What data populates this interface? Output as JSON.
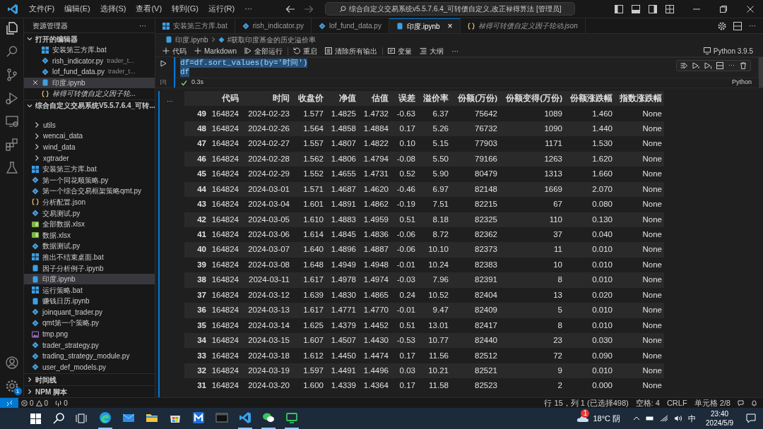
{
  "menu": [
    "文件(F)",
    "编辑(E)",
    "选择(S)",
    "查看(V)",
    "转到(G)",
    "运行(R)",
    "···"
  ],
  "command_center": "综合自定义交易系统v5.5.7.6.4_可转债自定义,改正禄得算法 [管理员]",
  "sidebar": {
    "title": "资源管理器",
    "more": "···",
    "open_editors": {
      "title": "打开的编辑器",
      "expanded": true,
      "items": [
        {
          "kind": "bat",
          "name": "安装第三方库.bat",
          "selected": false
        },
        {
          "kind": "py",
          "name": "rish_indicator.py",
          "desc": "trader_t...",
          "selected": false
        },
        {
          "kind": "py",
          "name": "lof_fund_data.py",
          "desc": "trader_t...",
          "selected": false
        },
        {
          "kind": "ipynb",
          "name": "印度.ipynb",
          "selected": true
        },
        {
          "kind": "json",
          "name": "禄得可转债自定义因子轮...",
          "italic": true,
          "selected": false
        }
      ]
    },
    "project": {
      "title": "综合自定义交易系统V5.5.7.6.4_可转...",
      "expanded": true,
      "items": [
        {
          "kind": "folder",
          "name": "utils",
          "selected": false
        },
        {
          "kind": "folder",
          "name": "wencai_data",
          "selected": false
        },
        {
          "kind": "folder",
          "name": "wind_data",
          "selected": false
        },
        {
          "kind": "folder",
          "name": "xgtrader",
          "selected": false
        },
        {
          "kind": "bat",
          "name": "安装第三方库.bat",
          "selected": false
        },
        {
          "kind": "py",
          "name": "第一个同花顺策略.py",
          "selected": false
        },
        {
          "kind": "py",
          "name": "第一个综合交易框架策略qmt.py",
          "selected": false
        },
        {
          "kind": "json",
          "name": "分析配置.json",
          "selected": false
        },
        {
          "kind": "py",
          "name": "交易测试.py",
          "selected": false
        },
        {
          "kind": "xlsx",
          "name": "全部数据.xlsx",
          "selected": false
        },
        {
          "kind": "xlsx",
          "name": "数据.xlsx",
          "selected": false
        },
        {
          "kind": "py",
          "name": "数据测试.py",
          "selected": false
        },
        {
          "kind": "bat",
          "name": "推出不结束桌面.bat",
          "selected": false
        },
        {
          "kind": "ipynb",
          "name": "因子分析例子.ipynb",
          "selected": false
        },
        {
          "kind": "ipynb",
          "name": "印度.ipynb",
          "selected": true
        },
        {
          "kind": "bat",
          "name": "运行策略.bat",
          "selected": false
        },
        {
          "kind": "ipynb",
          "name": "赚钱日历.ipynb",
          "selected": false
        },
        {
          "kind": "py",
          "name": "joinquant_trader.py",
          "selected": false
        },
        {
          "kind": "py",
          "name": "qmt第一个策略.py",
          "selected": false
        },
        {
          "kind": "png",
          "name": "tmp.png",
          "selected": false
        },
        {
          "kind": "py",
          "name": "trader_strategy.py",
          "selected": false
        },
        {
          "kind": "py",
          "name": "trading_strategy_module.py",
          "selected": false
        },
        {
          "kind": "py",
          "name": "user_def_models.py",
          "selected": false
        }
      ]
    },
    "bottom_sections": [
      {
        "title": "时间线",
        "expanded": false
      },
      {
        "title": "NPM 脚本",
        "expanded": false
      }
    ]
  },
  "settings_badge": "1",
  "tabs": [
    {
      "kind": "bat",
      "label": "安装第三方库.bat",
      "selected": false
    },
    {
      "kind": "py",
      "label": "rish_indicator.py",
      "selected": false
    },
    {
      "kind": "py",
      "label": "lof_fund_data.py",
      "selected": false
    },
    {
      "kind": "ipynb",
      "label": "印度.ipynb",
      "selected": true,
      "close": "×"
    },
    {
      "kind": "json",
      "label": "禄得可转债自定义因子轮动.json",
      "italic": true,
      "selected": false
    }
  ],
  "breadcrumb": [
    "印度.ipynb",
    "#获取印度基金的历史溢价率"
  ],
  "toolbar": [
    {
      "kind": "plus",
      "label": "代码"
    },
    {
      "kind": "plus",
      "label": "Markdown"
    },
    {
      "kind": "run",
      "label": "全部运行"
    },
    {
      "kind": "restart",
      "label": "重启"
    },
    {
      "kind": "clear",
      "label": "清除所有输出"
    },
    {
      "kind": "variables",
      "label": "变量"
    },
    {
      "kind": "outline",
      "label": "大纲"
    },
    {
      "kind": "more",
      "label": "···"
    }
  ],
  "kernel": "Python 3.9.5",
  "cell": {
    "code": [
      "df=df.sort_values(by='时间')",
      "df"
    ],
    "execution_count": "[3]",
    "duration": "0.3s",
    "language": "Python"
  },
  "output_more": "···",
  "table": {
    "columns": [
      "",
      "代码",
      "时间",
      "收盘价",
      "净值",
      "估值",
      "误差",
      "溢价率",
      "份额(万份)",
      "份额变得(万份)",
      "份额涨跌幅",
      "指数涨跌幅"
    ],
    "rows": [
      [
        "49",
        "164824",
        "2024-02-23",
        "1.577",
        "1.4825",
        "1.4732",
        "-0.63",
        "6.37",
        "75642",
        "1089",
        "1.460",
        "None"
      ],
      [
        "48",
        "164824",
        "2024-02-26",
        "1.564",
        "1.4858",
        "1.4884",
        "0.17",
        "5.26",
        "76732",
        "1090",
        "1.440",
        "None"
      ],
      [
        "47",
        "164824",
        "2024-02-27",
        "1.557",
        "1.4807",
        "1.4822",
        "0.10",
        "5.15",
        "77903",
        "1171",
        "1.530",
        "None"
      ],
      [
        "46",
        "164824",
        "2024-02-28",
        "1.562",
        "1.4806",
        "1.4794",
        "-0.08",
        "5.50",
        "79166",
        "1263",
        "1.620",
        "None"
      ],
      [
        "45",
        "164824",
        "2024-02-29",
        "1.552",
        "1.4655",
        "1.4731",
        "0.52",
        "5.90",
        "80479",
        "1313",
        "1.660",
        "None"
      ],
      [
        "44",
        "164824",
        "2024-03-01",
        "1.571",
        "1.4687",
        "1.4620",
        "-0.46",
        "6.97",
        "82148",
        "1669",
        "2.070",
        "None"
      ],
      [
        "43",
        "164824",
        "2024-03-04",
        "1.601",
        "1.4891",
        "1.4862",
        "-0.19",
        "7.51",
        "82215",
        "67",
        "0.080",
        "None"
      ],
      [
        "42",
        "164824",
        "2024-03-05",
        "1.610",
        "1.4883",
        "1.4959",
        "0.51",
        "8.18",
        "82325",
        "110",
        "0.130",
        "None"
      ],
      [
        "41",
        "164824",
        "2024-03-06",
        "1.614",
        "1.4845",
        "1.4836",
        "-0.06",
        "8.72",
        "82362",
        "37",
        "0.040",
        "None"
      ],
      [
        "40",
        "164824",
        "2024-03-07",
        "1.640",
        "1.4896",
        "1.4887",
        "-0.06",
        "10.10",
        "82373",
        "11",
        "0.010",
        "None"
      ],
      [
        "39",
        "164824",
        "2024-03-08",
        "1.648",
        "1.4949",
        "1.4948",
        "-0.01",
        "10.24",
        "82383",
        "10",
        "0.010",
        "None"
      ],
      [
        "38",
        "164824",
        "2024-03-11",
        "1.617",
        "1.4978",
        "1.4974",
        "-0.03",
        "7.96",
        "82391",
        "8",
        "0.010",
        "None"
      ],
      [
        "37",
        "164824",
        "2024-03-12",
        "1.639",
        "1.4830",
        "1.4865",
        "0.24",
        "10.52",
        "82404",
        "13",
        "0.020",
        "None"
      ],
      [
        "36",
        "164824",
        "2024-03-13",
        "1.617",
        "1.4771",
        "1.4770",
        "-0.01",
        "9.47",
        "82409",
        "5",
        "0.010",
        "None"
      ],
      [
        "35",
        "164824",
        "2024-03-14",
        "1.625",
        "1.4379",
        "1.4452",
        "0.51",
        "13.01",
        "82417",
        "8",
        "0.010",
        "None"
      ],
      [
        "34",
        "164824",
        "2024-03-15",
        "1.607",
        "1.4507",
        "1.4430",
        "-0.53",
        "10.77",
        "82440",
        "23",
        "0.030",
        "None"
      ],
      [
        "33",
        "164824",
        "2024-03-18",
        "1.612",
        "1.4450",
        "1.4474",
        "0.17",
        "11.56",
        "82512",
        "72",
        "0.090",
        "None"
      ],
      [
        "32",
        "164824",
        "2024-03-19",
        "1.597",
        "1.4491",
        "1.4496",
        "0.03",
        "10.21",
        "82521",
        "9",
        "0.010",
        "None"
      ],
      [
        "31",
        "164824",
        "2024-03-20",
        "1.600",
        "1.4339",
        "1.4364",
        "0.17",
        "11.58",
        "82523",
        "2",
        "0.000",
        "None"
      ]
    ]
  },
  "status_bar": {
    "errors": "0",
    "warnings": "0",
    "ports": "0",
    "right": [
      "行 15，列 1 (已选择498)",
      "空格: 4",
      "CRLF",
      "单元格 2/8"
    ]
  },
  "taskbar": {
    "weather_badge": "1",
    "weather": "18°C 阴",
    "ime": "中",
    "time": "23:40",
    "date": "2024/5/9"
  }
}
